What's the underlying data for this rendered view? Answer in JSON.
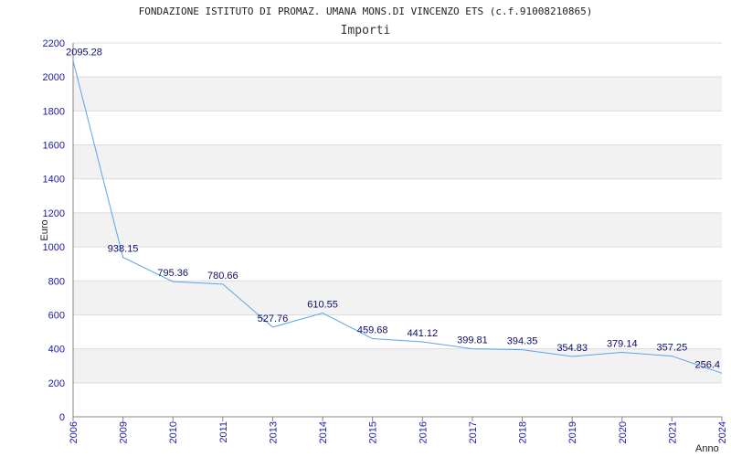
{
  "chart_data": {
    "type": "line",
    "title": "FONDAZIONE ISTITUTO DI PROMAZ. UMANA MONS.DI VINCENZO ETS (c.f.91008210865)",
    "subtitle": "Importi",
    "xlabel": "Anno",
    "ylabel": "Euro",
    "ylim": [
      0,
      2200
    ],
    "yticks": [
      0,
      200,
      400,
      600,
      800,
      1000,
      1200,
      1400,
      1600,
      1800,
      2000,
      2200
    ],
    "grid": "horizontal alternating bands",
    "categories": [
      "2006",
      "2009",
      "2010",
      "2011",
      "2013",
      "2014",
      "2015",
      "2016",
      "2017",
      "2018",
      "2019",
      "2020",
      "2021",
      "2024"
    ],
    "values": [
      2095.28,
      938.15,
      795.36,
      780.66,
      527.76,
      610.55,
      459.68,
      441.12,
      399.81,
      394.35,
      354.83,
      379.14,
      357.25,
      256.4
    ],
    "value_labels": [
      "2095.28",
      "938.15",
      "795.36",
      "780.66",
      "527.76",
      "610.55",
      "459.68",
      "441.12",
      "399.81",
      "394.35",
      "354.83",
      "379.14",
      "357.25",
      "256.4"
    ],
    "colors": {
      "line": "#5aa5e6",
      "band": "#f2f2f2",
      "gridline": "#dcdcdc",
      "axis": "#888888",
      "tick_text": "#1a1aa6",
      "data_label": "#0d0d6b"
    }
  }
}
